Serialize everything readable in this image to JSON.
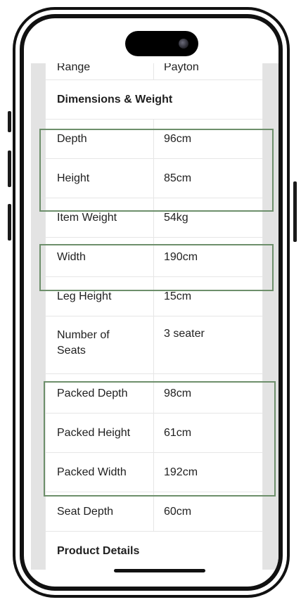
{
  "spec_table": {
    "rows": [
      {
        "label": "Range",
        "value": "Payton",
        "type": "data"
      },
      {
        "label": "Dimensions & Weight",
        "value": "",
        "type": "section"
      },
      {
        "label": "Depth",
        "value": "96cm",
        "type": "data"
      },
      {
        "label": "Height",
        "value": "85cm",
        "type": "data"
      },
      {
        "label": "Item Weight",
        "value": "54kg",
        "type": "data"
      },
      {
        "label": "Width",
        "value": "190cm",
        "type": "data"
      },
      {
        "label": "Leg Height",
        "value": "15cm",
        "type": "data"
      },
      {
        "label": "Number of Seats",
        "value": "3 seater",
        "type": "multi"
      },
      {
        "label": "Packed Depth",
        "value": "98cm",
        "type": "data"
      },
      {
        "label": "Packed Height",
        "value": "61cm",
        "type": "data"
      },
      {
        "label": "Packed Width",
        "value": "192cm",
        "type": "data"
      },
      {
        "label": "Seat Depth",
        "value": "60cm",
        "type": "data"
      },
      {
        "label": "Product Details",
        "value": "",
        "type": "section"
      }
    ]
  },
  "highlight_color": "#6d8f6b"
}
